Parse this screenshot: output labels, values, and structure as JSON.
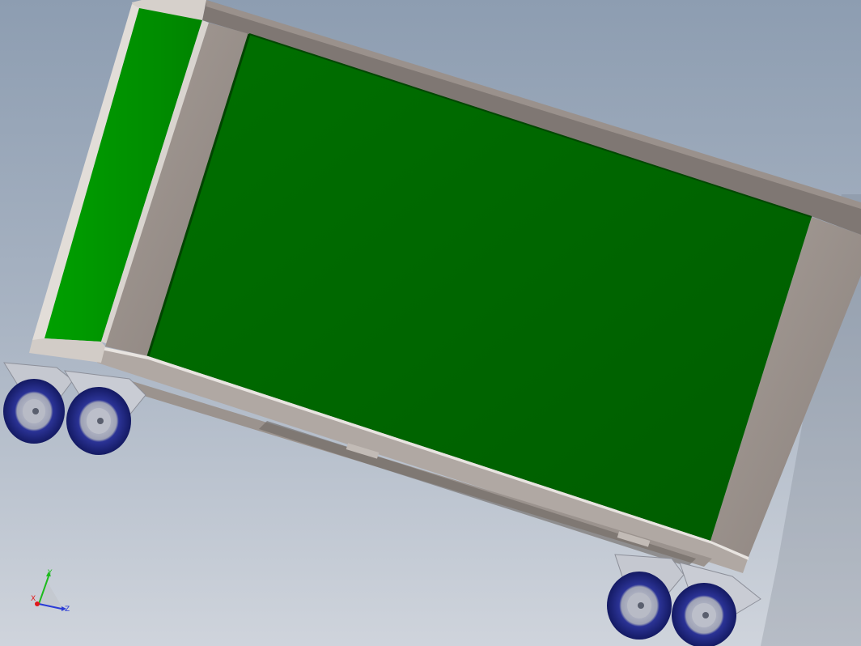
{
  "viewport": {
    "background_top": "#8d9db1",
    "background_bottom": "#cfd4dc"
  },
  "model": {
    "panel_color": "#006400",
    "side_panel_color": "#008e00",
    "frame_color": "#948a85",
    "frame_edge_color": "#7a726e",
    "wheel_color": "#262f86",
    "caster_color": "#c9ccd4"
  },
  "triad": {
    "y_label": "Y",
    "x_label": "X",
    "z_label": "Z",
    "y_color": "#1dbb1d",
    "x_color": "#e01a1a",
    "z_color": "#2a3bd6"
  }
}
